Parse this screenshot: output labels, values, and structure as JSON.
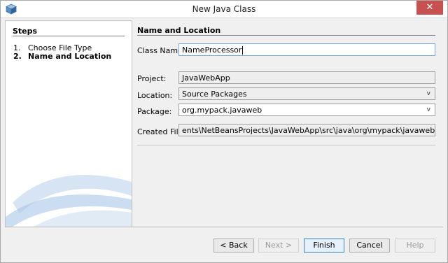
{
  "window": {
    "title": "New Java Class",
    "close_glyph": "✕"
  },
  "steps": {
    "title": "Steps",
    "items": [
      {
        "num": "1.",
        "label": "Choose File Type"
      },
      {
        "num": "2.",
        "label": "Name and Location"
      }
    ]
  },
  "form": {
    "section_title": "Name and Location",
    "class_name": {
      "label": "Class Name:",
      "value": "NameProcessor"
    },
    "project": {
      "label": "Project:",
      "value": "JavaWebApp"
    },
    "location": {
      "label": "Location:",
      "value": "Source Packages"
    },
    "package": {
      "label": "Package:",
      "value": "org.mypack.javaweb"
    },
    "created_file": {
      "label": "Created File:",
      "value": "ents\\NetBeansProjects\\JavaWebApp\\src\\java\\org\\mypack\\javaweb\\NameProcessor"
    },
    "dropdown_glyph": "v"
  },
  "buttons": {
    "back": "< Back",
    "next": "Next >",
    "finish": "Finish",
    "cancel": "Cancel",
    "help": "Help"
  },
  "colors": {
    "close_button": "#c75050",
    "default_button_border": "#3c7fb1"
  }
}
